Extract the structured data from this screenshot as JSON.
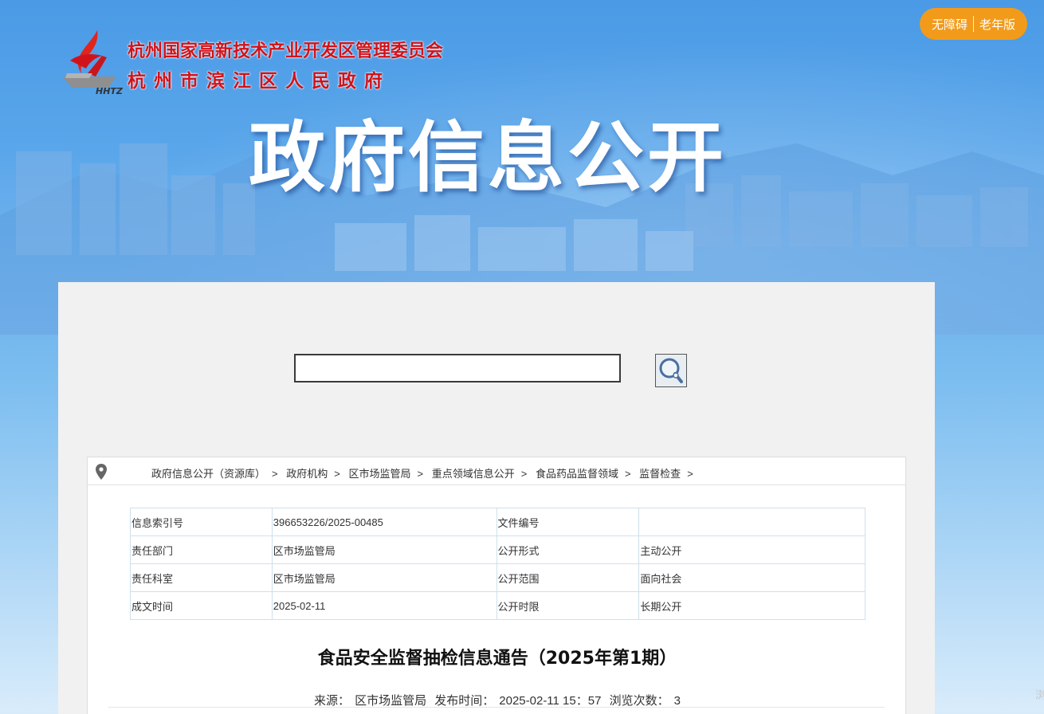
{
  "header": {
    "org_name_1": "杭州国家高新技术产业开发区管理委员会",
    "org_name_2": "杭州市滨江区人民政府",
    "logo_text": "HHTZ",
    "hero_title": "政府信息公开",
    "accessibility_label": "无障碍",
    "elder_label": "老年版"
  },
  "search": {
    "value": "",
    "placeholder": ""
  },
  "breadcrumb": {
    "items": [
      "政府信息公开（资源库）",
      "政府机构",
      "区市场监管局",
      "重点领域信息公开",
      "食品药品监督领域",
      "监督检查"
    ],
    "separator": ">"
  },
  "meta_table": {
    "rows": [
      [
        "信息索引号",
        "396653226/2025-00485",
        "文件编号",
        ""
      ],
      [
        "责任部门",
        "区市场监管局",
        "公开形式",
        "主动公开"
      ],
      [
        "责任科室",
        "区市场监管局",
        "公开范围",
        "面向社会"
      ],
      [
        "成文时间",
        "2025-02-11",
        "公开时限",
        "长期公开"
      ]
    ]
  },
  "document": {
    "title": "食品安全监督抽检信息通告（2025年第1期）",
    "source_label": "来源：",
    "source_value": "区市场监管局",
    "publish_label": "发布时间：",
    "publish_value": "2025-02-11 15：57",
    "views_label": "浏览次数：",
    "views_value": "3"
  },
  "side_char": "浏",
  "colors": {
    "accent_orange": "#f29b1a",
    "banner_blue": "#4f9fe6",
    "logo_red": "#d0131b"
  }
}
